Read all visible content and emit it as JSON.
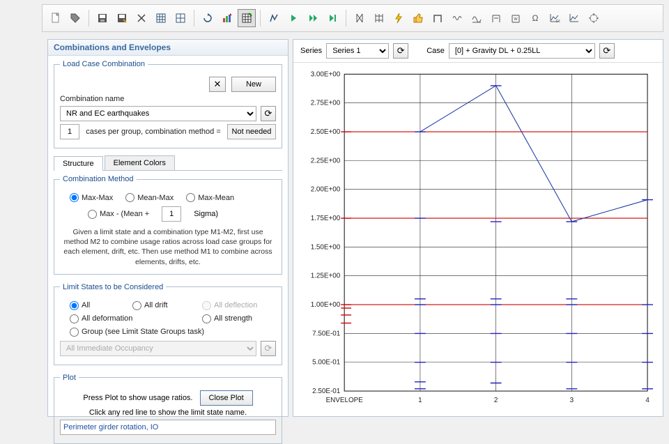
{
  "panel_title": "Combinations and Envelopes",
  "load_case": {
    "legend": "Load Case Combination",
    "combo_name_label": "Combination  name",
    "combo_name_value": "NR and EC earthquakes",
    "x_label": "✕",
    "new_label": "New",
    "cases_count": "1",
    "cases_label": "cases per group, combination method =",
    "method_value": "Not needed"
  },
  "tabs": {
    "structure": "Structure",
    "element_colors": "Element Colors"
  },
  "combo_method": {
    "legend": "Combination Method",
    "opt1": "Max-Max",
    "opt2": "Mean-Max",
    "opt3": "Max-Mean",
    "opt4a": "Max - (Mean +",
    "opt4b": "Sigma)",
    "sigma_value": "1",
    "help": "Given a limit state and a combination type M1-M2, first use method M2 to combine usage ratios across load case groups for each element, drift, etc. Then use method M1 to combine across elements, drifts, etc."
  },
  "limit_states": {
    "legend": "Limit States to be Considered",
    "opt_all": "All",
    "opt_drift": "All drift",
    "opt_deflection": "All deflection",
    "opt_deform": "All deformation",
    "opt_strength": "All strength",
    "opt_group": "Group (see Limit State Groups task)",
    "group_select": "All Immediate Occupancy"
  },
  "plot": {
    "legend": "Plot",
    "press": "Press Plot to show usage ratios.",
    "close": "Close Plot",
    "click": "Click any red line to show the limit state name.",
    "name": "Perimeter girder rotation, IO"
  },
  "right": {
    "series_label": "Series",
    "series_value": "Series 1",
    "case_label": "Case",
    "case_value": "[0] + Gravity DL + 0.25LL"
  },
  "chart_data": {
    "type": "line",
    "xlabel": "",
    "ylabel": "",
    "x_categories": [
      "ENVELOPE",
      "1",
      "2",
      "3",
      "4"
    ],
    "yticks": [
      "2.50E-01",
      "5.00E-01",
      "7.50E-01",
      "1.00E+00",
      "1.25E+00",
      "1.50E+00",
      "1.75E+00",
      "2.00E+00",
      "2.25E+00",
      "2.50E+00",
      "2.75E+00",
      "3.00E+00"
    ],
    "ylim": [
      0.25,
      3.0
    ],
    "series": [
      {
        "name": "Series 1",
        "x": [
          1,
          2,
          3,
          4
        ],
        "y": [
          2.5,
          2.9,
          1.72,
          1.91
        ]
      }
    ],
    "red_reference_lines_y": [
      1.0,
      1.75,
      2.5
    ],
    "red_env_marks_y": [
      0.84,
      0.91,
      0.97,
      1.0,
      1.75,
      2.5
    ],
    "blue_marks": {
      "1": [
        0.27,
        0.33,
        0.5,
        0.75,
        1.0,
        1.05,
        1.75,
        2.5
      ],
      "2": [
        0.32,
        0.5,
        0.75,
        1.0,
        1.05,
        1.72,
        2.9
      ],
      "3": [
        0.27,
        0.5,
        0.75,
        1.0,
        1.05,
        1.72
      ],
      "4": [
        0.27,
        0.5,
        0.75,
        1.0,
        1.91
      ]
    }
  },
  "toolbar_icons": [
    "new-doc",
    "tag",
    "save",
    "save-as",
    "cut",
    "table",
    "table2",
    "refresh",
    "bar-go",
    "grid-go",
    "",
    "run",
    "play",
    "play-next",
    "step",
    "",
    "braces1",
    "braces2",
    "bolt",
    "thumbs",
    "frame",
    "wave",
    "wave2",
    "beam",
    "beam-w",
    "omega",
    "chart-dc",
    "chart",
    "target"
  ]
}
